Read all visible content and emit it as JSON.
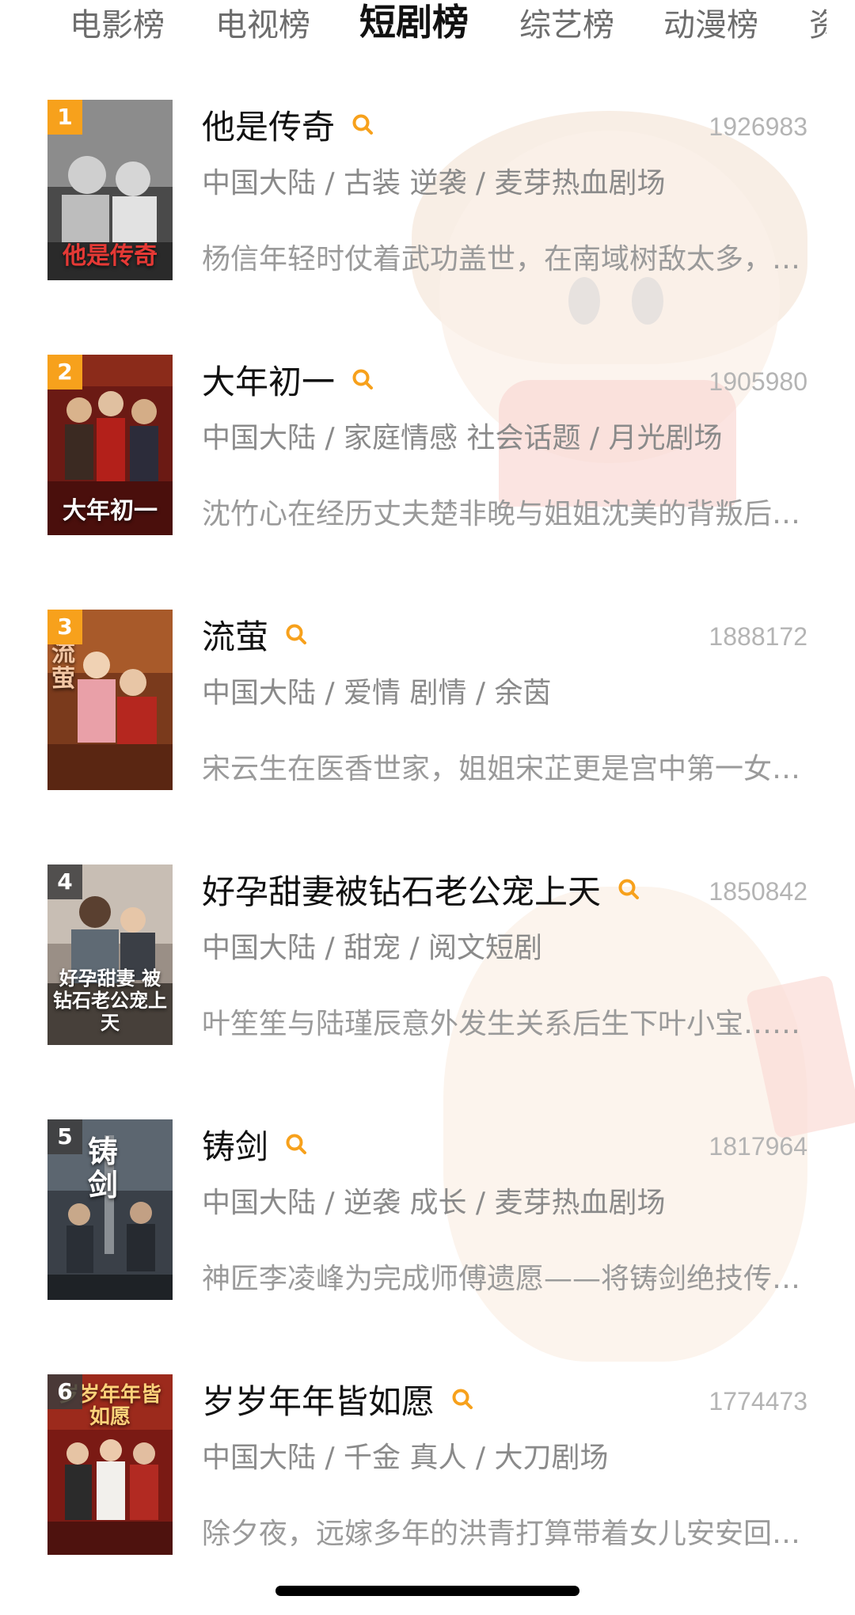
{
  "tabs": [
    {
      "label": "电影榜",
      "active": false
    },
    {
      "label": "电视榜",
      "active": false
    },
    {
      "label": "短剧榜",
      "active": true
    },
    {
      "label": "综艺榜",
      "active": false
    },
    {
      "label": "动漫榜",
      "active": false
    },
    {
      "label": "资",
      "active": false
    }
  ],
  "colors": {
    "accent": "#f7a11c",
    "title": "#111111",
    "meta": "#8a8a8a",
    "score": "#b4b4b4"
  },
  "search_icon": "search-icon",
  "items": [
    {
      "rank": "1",
      "title": "他是传奇",
      "score": "1926983",
      "tags": "中国大陆 / 古装 逆袭 / 麦芽热血剧场",
      "desc": "杨信年轻时仗着武功盖世，在南域树敌太多，为了保护家人隐居多年……",
      "poster_caption": "他是传奇"
    },
    {
      "rank": "2",
      "title": "大年初一",
      "score": "1905980",
      "tags": "中国大陆 / 家庭情感 社会话题 / 月光剧场",
      "desc": "沈竹心在经历丈夫楚非晚与姐姐沈美的背叛后……",
      "poster_caption": "大年初一"
    },
    {
      "rank": "3",
      "title": "流萤",
      "score": "1888172",
      "tags": "中国大陆 / 爱情 剧情 / 余茵",
      "desc": "宋云生在医香世家，姐姐宋芷更是宫中第一女医……",
      "poster_caption": "流萤"
    },
    {
      "rank": "4",
      "title": "好孕甜妻被钻石老公宠上天",
      "score": "1850842",
      "tags": "中国大陆 / 甜宠 / 阅文短剧",
      "desc": "叶笙笙与陆瑾辰意外发生关系后生下叶小宝……",
      "poster_caption": "好孕甜妻 被钻石老公宠上天"
    },
    {
      "rank": "5",
      "title": "铸剑",
      "score": "1817964",
      "tags": "中国大陆 / 逆袭 成长 / 麦芽热血剧场",
      "desc": "神匠李凌峰为完成师傅遗愿——将铸剑绝技传承下去……",
      "poster_caption": "铸剑"
    },
    {
      "rank": "6",
      "title": "岁岁年年皆如愿",
      "score": "1774473",
      "tags": "中国大陆 / 千金 真人 / 大刀剧场",
      "desc": "除夕夜，远嫁多年的洪青打算带着女儿安安回家……",
      "poster_caption": "岁岁年年皆如愿"
    }
  ]
}
